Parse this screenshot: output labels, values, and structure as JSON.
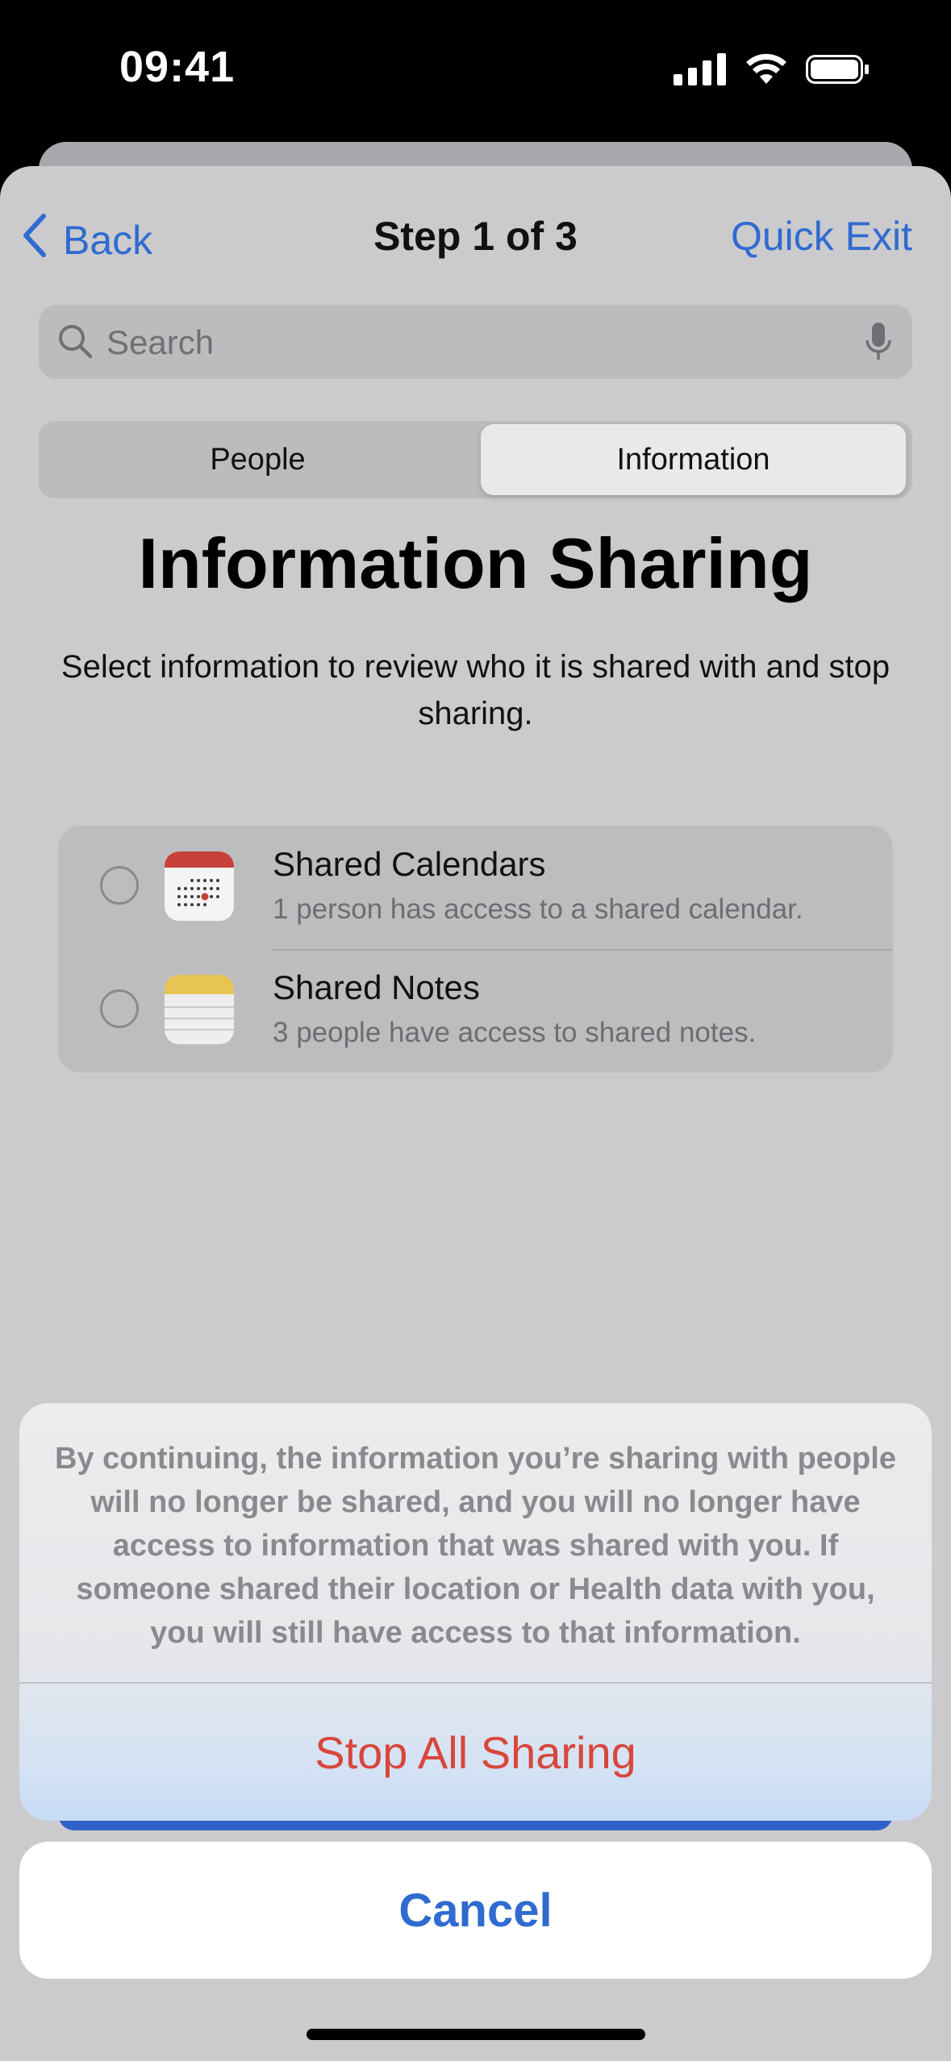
{
  "status_bar": {
    "time": "09:41"
  },
  "nav": {
    "back_label": "Back",
    "title": "Step 1 of 3",
    "quick_exit_label": "Quick Exit"
  },
  "search": {
    "placeholder": "Search"
  },
  "segments": [
    {
      "label": "People",
      "selected": false
    },
    {
      "label": "Information",
      "selected": true
    }
  ],
  "page": {
    "heading": "Information Sharing",
    "description": "Select information to review who it is shared with and stop sharing."
  },
  "items": [
    {
      "title": "Shared Calendars",
      "subtitle": "1 person has access to a shared calendar.",
      "icon": "calendar-app-icon",
      "checked": false
    },
    {
      "title": "Shared Notes",
      "subtitle": "3 people have access to shared notes.",
      "icon": "notes-app-icon",
      "checked": false
    }
  ],
  "action_sheet": {
    "message": "By continuing, the information you’re sharing with people will no longer be shared, and you will no longer have access to information that was shared with you. If someone shared their location or Health data with you, you will still have access to that information.",
    "destructive_label": "Stop All Sharing",
    "cancel_label": "Cancel"
  },
  "colors": {
    "accent": "#2f6bd0",
    "destructive": "#d9463b",
    "dim_background": "#cbcbcd"
  }
}
